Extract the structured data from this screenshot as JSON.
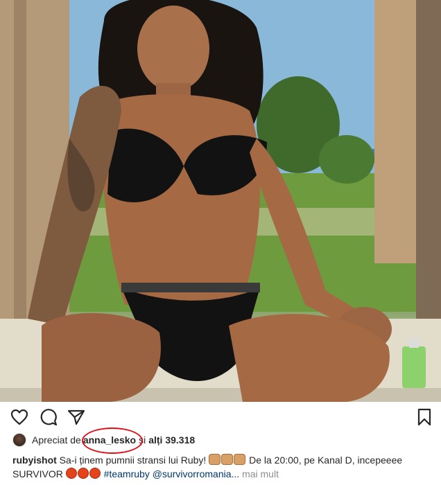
{
  "post": {
    "image_alt": "photo",
    "likes": {
      "prefix": "Apreciat de",
      "user": "anna_lesko",
      "connector": "și",
      "others": "alți 39.318"
    },
    "caption": {
      "author": "rubyishot",
      "text_1": "Sa-i ținem pumnii stransi lui Ruby!",
      "text_2": "De la 20:00, pe Kanal D, incepeeee SURVIVOR",
      "hashtag": "#teamruby",
      "mention": "@survivorromania...",
      "more": "mai mult"
    },
    "icons": {
      "like": "heart-icon",
      "comment": "comment-icon",
      "share": "share-icon",
      "save": "bookmark-icon"
    },
    "colors": {
      "highlight_oval": "#e0101a",
      "link": "#00376b",
      "muted": "#8e8e8e"
    }
  }
}
